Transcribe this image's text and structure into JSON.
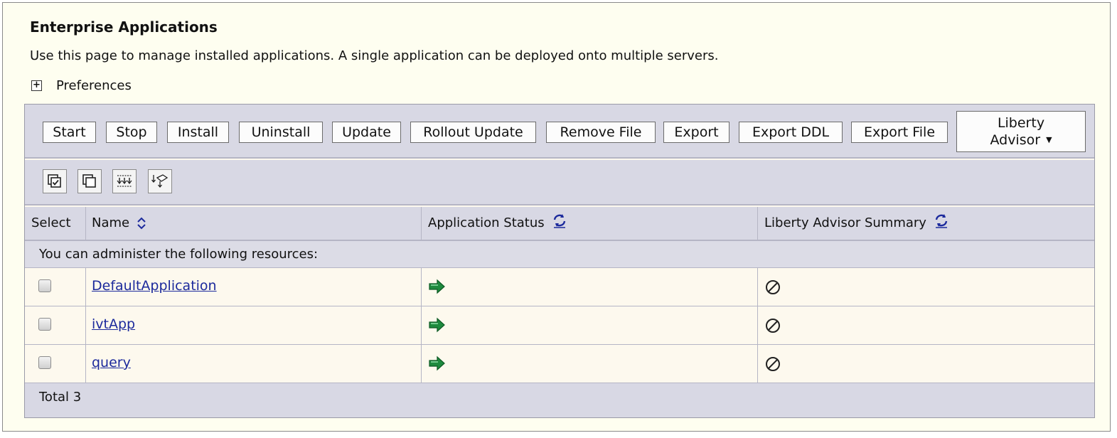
{
  "page": {
    "title": "Enterprise Applications",
    "description": "Use this page to manage installed applications. A single application can be deployed onto multiple servers.",
    "preferences_label": "Preferences"
  },
  "toolbar": {
    "start": "Start",
    "stop": "Stop",
    "install": "Install",
    "uninstall": "Uninstall",
    "update": "Update",
    "rollout_update": "Rollout Update",
    "remove_file": "Remove File",
    "export": "Export",
    "export_ddl": "Export DDL",
    "export_file": "Export File",
    "liberty_advisor_line1": "Liberty",
    "liberty_advisor_line2": "Advisor"
  },
  "icons": {
    "select_all": "select-all-icon",
    "deselect_all": "deselect-all-icon",
    "filter": "show-filter-icon",
    "clear_filter": "clear-filter-icon",
    "sort": "sort-icon",
    "refresh": "refresh-icon",
    "started": "started-arrow-icon",
    "not_available": "not-available-icon"
  },
  "colors": {
    "link": "#1c2a9c",
    "status_green": "#1e8a3e",
    "panel_header": "#d8d8e4",
    "page_bg": "#fefef0"
  },
  "table": {
    "headers": {
      "select": "Select",
      "name": "Name",
      "status": "Application Status",
      "advisor": "Liberty Advisor Summary"
    },
    "group_label": "You can administer the following resources:",
    "rows": [
      {
        "name": "DefaultApplication",
        "status": "started",
        "advisor": "not-available"
      },
      {
        "name": "ivtApp",
        "status": "started",
        "advisor": "not-available"
      },
      {
        "name": "query",
        "status": "started",
        "advisor": "not-available"
      }
    ],
    "total_label": "Total 3"
  }
}
